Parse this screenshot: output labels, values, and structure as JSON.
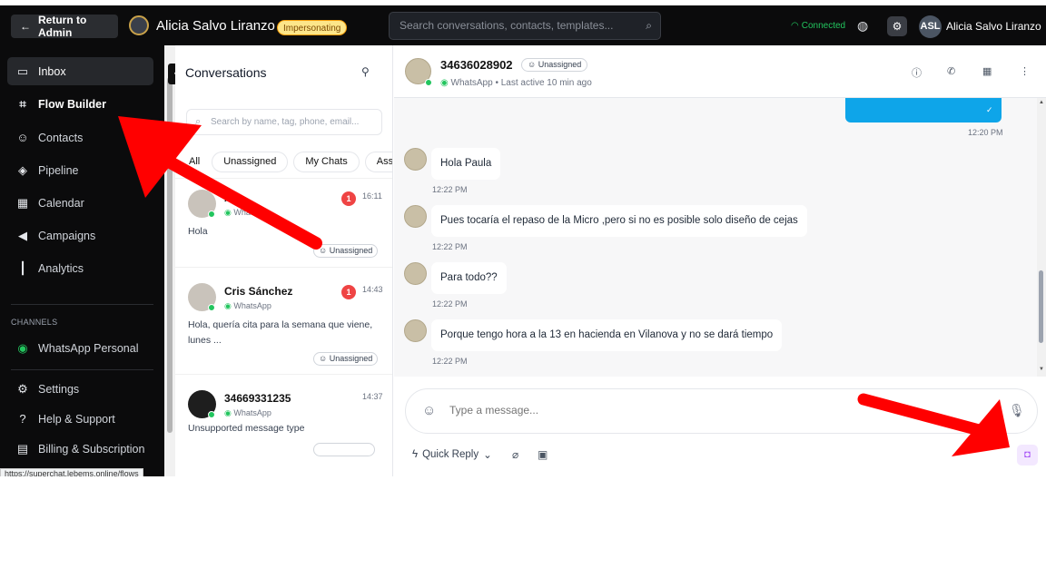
{
  "topbar": {
    "return_label": "Return to Admin",
    "user_title": "Alicia Salvo Liranzo",
    "impersonating": "Impersonating",
    "search_placeholder": "Search conversations, contacts, templates...",
    "connection_status": "Connected",
    "avatar_initials": "ASL",
    "user_name": "Alicia Salvo Liranzo"
  },
  "sidebar": {
    "items": [
      {
        "label": "Inbox",
        "icon": "inbox-icon"
      },
      {
        "label": "Flow Builder",
        "icon": "flow-icon"
      },
      {
        "label": "Contacts",
        "icon": "contacts-icon"
      },
      {
        "label": "Pipeline",
        "icon": "pipeline-icon"
      },
      {
        "label": "Calendar",
        "icon": "calendar-icon"
      },
      {
        "label": "Campaigns",
        "icon": "megaphone-icon"
      },
      {
        "label": "Analytics",
        "icon": "analytics-icon"
      }
    ],
    "channels_label": "CHANNELS",
    "channel_item": "WhatsApp Personal",
    "bottom_items": [
      {
        "label": "Settings",
        "icon": "settings-icon"
      },
      {
        "label": "Help & Support",
        "icon": "help-icon"
      },
      {
        "label": "Billing & Subscription",
        "icon": "billing-icon"
      }
    ],
    "status_url": "https://superchat.lebems.online/flows"
  },
  "conversations": {
    "title": "Conversations",
    "search_placeholder": "Search by name, tag, phone, email...",
    "tabs": [
      "All",
      "Unassigned",
      "My Chats",
      "Assi"
    ],
    "items": [
      {
        "name": "A",
        "channel": "WhatsApp",
        "time": "16:11",
        "unread": "1",
        "preview": "Hola",
        "assign": "Unassigned"
      },
      {
        "name": "Cris Sánchez",
        "channel": "WhatsApp",
        "time": "14:43",
        "unread": "1",
        "preview": "Hola, quería cita para la semana que viene, lunes ...",
        "assign": "Unassigned"
      },
      {
        "name": "34669331235",
        "channel": "WhatsApp",
        "time": "14:37",
        "unread": "",
        "preview": "Unsupported message type",
        "assign": ""
      }
    ]
  },
  "chat": {
    "name": "34636028902",
    "badge": "Unassigned",
    "channel": "WhatsApp",
    "last_active": "Last active 10 min ago",
    "outgoing_time": "12:20 PM",
    "messages": [
      {
        "text": "Hola Paula",
        "time": "12:22 PM"
      },
      {
        "text": "Pues tocaría el repaso de la Micro ,pero si no es posible solo diseño de cejas",
        "time": "12:22 PM"
      },
      {
        "text": "Para todo??",
        "time": "12:22 PM"
      },
      {
        "text": "Porque tengo hora a la 13 en hacienda en Vilanova y no se dará tiempo",
        "time": "12:22 PM"
      }
    ],
    "composer_placeholder": "Type a message...",
    "quick_reply": "Quick Reply"
  },
  "colors": {
    "sidebar_bg": "#0b0b0c",
    "outgoing_bubble": "#0ea5e9",
    "connected": "#22c55e",
    "badge_bg": "#fde68a",
    "unread": "#ef4444",
    "annotation_arrow": "#ff0000"
  }
}
